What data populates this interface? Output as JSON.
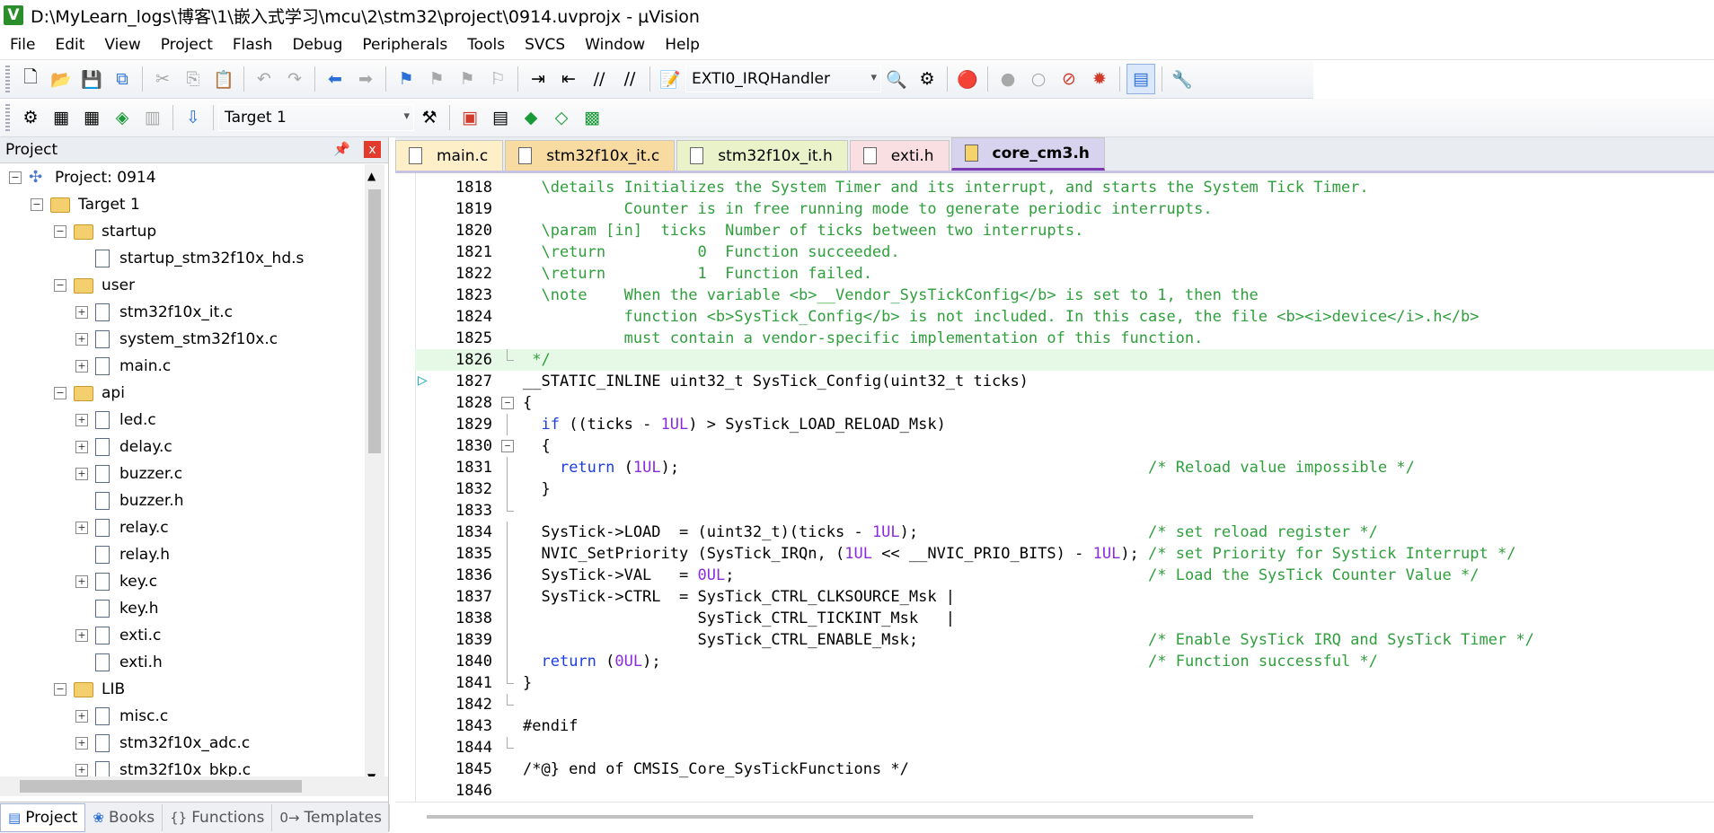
{
  "window": {
    "title": "D:\\MyLearn_logs\\博客\\1\\嵌入式学习\\mcu\\2\\stm32\\project\\0914.uvprojx - µVision",
    "logo": "V"
  },
  "menu": [
    "File",
    "Edit",
    "View",
    "Project",
    "Flash",
    "Debug",
    "Peripherals",
    "Tools",
    "SVCS",
    "Window",
    "Help"
  ],
  "toolbar1": {
    "function_combo": "EXTI0_IRQHandler"
  },
  "toolbar2": {
    "target_combo": "Target 1"
  },
  "project_panel": {
    "title": "Project",
    "pin": "ᵖ",
    "close": "x",
    "items": [
      {
        "label": "Project: 0914",
        "level": 0,
        "type": "project",
        "exp": "−"
      },
      {
        "label": "Target 1",
        "level": 1,
        "type": "folder",
        "exp": "−"
      },
      {
        "label": "startup",
        "level": 2,
        "type": "folder",
        "exp": "−"
      },
      {
        "label": "startup_stm32f10x_hd.s",
        "level": 3,
        "type": "file",
        "exp": ""
      },
      {
        "label": "user",
        "level": 2,
        "type": "folder",
        "exp": "−"
      },
      {
        "label": "stm32f10x_it.c",
        "level": 3,
        "type": "file",
        "exp": "+"
      },
      {
        "label": "system_stm32f10x.c",
        "level": 3,
        "type": "file",
        "exp": "+"
      },
      {
        "label": "main.c",
        "level": 3,
        "type": "file",
        "exp": "+"
      },
      {
        "label": "api",
        "level": 2,
        "type": "folder",
        "exp": "−"
      },
      {
        "label": "led.c",
        "level": 3,
        "type": "file",
        "exp": "+"
      },
      {
        "label": "delay.c",
        "level": 3,
        "type": "file",
        "exp": "+"
      },
      {
        "label": "buzzer.c",
        "level": 3,
        "type": "file",
        "exp": "+"
      },
      {
        "label": "buzzer.h",
        "level": 3,
        "type": "file",
        "exp": ""
      },
      {
        "label": "relay.c",
        "level": 3,
        "type": "file",
        "exp": "+"
      },
      {
        "label": "relay.h",
        "level": 3,
        "type": "file",
        "exp": ""
      },
      {
        "label": "key.c",
        "level": 3,
        "type": "file",
        "exp": "+"
      },
      {
        "label": "key.h",
        "level": 3,
        "type": "file",
        "exp": ""
      },
      {
        "label": "exti.c",
        "level": 3,
        "type": "file",
        "exp": "+"
      },
      {
        "label": "exti.h",
        "level": 3,
        "type": "file",
        "exp": ""
      },
      {
        "label": "LIB",
        "level": 2,
        "type": "folder",
        "exp": "−"
      },
      {
        "label": "misc.c",
        "level": 3,
        "type": "file",
        "exp": "+"
      },
      {
        "label": "stm32f10x_adc.c",
        "level": 3,
        "type": "file",
        "exp": "+"
      },
      {
        "label": "stm32f10x_bkp.c",
        "level": 3,
        "type": "file",
        "exp": "+"
      }
    ],
    "tabs": [
      {
        "label": "Project",
        "icon": "▤"
      },
      {
        "label": "Books",
        "icon": "❀"
      },
      {
        "label": "Functions",
        "icon": "{}"
      },
      {
        "label": "Templates",
        "icon": "0→"
      }
    ]
  },
  "editor_tabs": [
    "main.c",
    "stm32f10x_it.c",
    "stm32f10x_it.h",
    "exti.h",
    "core_cm3.h"
  ],
  "code_lines": [
    {
      "n": "1818",
      "t": "  \\details Initializes the System Timer and its interrupt, and starts the System Tick Timer.",
      "c": "cmt"
    },
    {
      "n": "1819",
      "t": "           Counter is in free running mode to generate periodic interrupts.",
      "c": "cmt"
    },
    {
      "n": "1820",
      "t": "  \\param [in]  ticks  Number of ticks between two interrupts.",
      "c": "cmt"
    },
    {
      "n": "1821",
      "t": "  \\return          0  Function succeeded.",
      "c": "cmt"
    },
    {
      "n": "1822",
      "t": "  \\return          1  Function failed.",
      "c": "cmt"
    },
    {
      "n": "1823",
      "t": "  \\note    When the variable <b>__Vendor_SysTickConfig</b> is set to 1, then the",
      "c": "cmt"
    },
    {
      "n": "1824",
      "t": "           function <b>SysTick_Config</b> is not included. In this case, the file <b><i>device</i>.h</b>",
      "c": "cmt"
    },
    {
      "n": "1825",
      "t": "           must contain a vendor-specific implementation of this function.",
      "c": "cmt"
    },
    {
      "n": "1826",
      "t": " */",
      "c": "cmt cur"
    },
    {
      "n": "1827",
      "t": "__STATIC_INLINE uint32_t SysTick_Config(uint32_t ticks)",
      "c": ""
    },
    {
      "n": "1828",
      "t": "{",
      "c": ""
    },
    {
      "n": "1829",
      "t": "  if ((ticks - 1UL) > SysTick_LOAD_RELOAD_Msk)",
      "c": ""
    },
    {
      "n": "1830",
      "t": "  {",
      "c": ""
    },
    {
      "n": "1831",
      "t": "    return (1UL);                                                   /* Reload value impossible */",
      "c": ""
    },
    {
      "n": "1832",
      "t": "  }",
      "c": ""
    },
    {
      "n": "1833",
      "t": "",
      "c": ""
    },
    {
      "n": "1834",
      "t": "  SysTick->LOAD  = (uint32_t)(ticks - 1UL);                         /* set reload register */",
      "c": ""
    },
    {
      "n": "1835",
      "t": "  NVIC_SetPriority (SysTick_IRQn, (1UL << __NVIC_PRIO_BITS) - 1UL); /* set Priority for Systick Interrupt */",
      "c": ""
    },
    {
      "n": "1836",
      "t": "  SysTick->VAL   = 0UL;                                             /* Load the SysTick Counter Value */",
      "c": ""
    },
    {
      "n": "1837",
      "t": "  SysTick->CTRL  = SysTick_CTRL_CLKSOURCE_Msk |",
      "c": ""
    },
    {
      "n": "1838",
      "t": "                   SysTick_CTRL_TICKINT_Msk   |",
      "c": ""
    },
    {
      "n": "1839",
      "t": "                   SysTick_CTRL_ENABLE_Msk;                         /* Enable SysTick IRQ and SysTick Timer */",
      "c": ""
    },
    {
      "n": "1840",
      "t": "  return (0UL);                                                     /* Function successful */",
      "c": ""
    },
    {
      "n": "1841",
      "t": "}",
      "c": ""
    },
    {
      "n": "1842",
      "t": "",
      "c": ""
    },
    {
      "n": "1843",
      "t": "#endif",
      "c": ""
    },
    {
      "n": "1844",
      "t": "",
      "c": ""
    },
    {
      "n": "1845",
      "t": "/*@} end of CMSIS_Core_SysTickFunctions */",
      "c": ""
    },
    {
      "n": "1846",
      "t": "",
      "c": ""
    }
  ]
}
